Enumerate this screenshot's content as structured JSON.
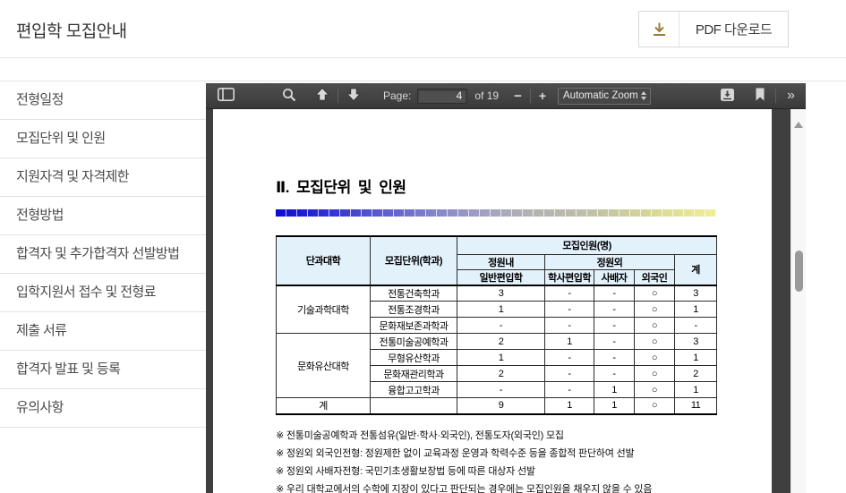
{
  "page": {
    "title": "편입학 모집안내",
    "download_button_label": "PDF 다운로드"
  },
  "sidebar": {
    "items": [
      {
        "label": "전형일정"
      },
      {
        "label": "모집단위 및 인원"
      },
      {
        "label": "지원자격 및 자격제한"
      },
      {
        "label": "전형방법"
      },
      {
        "label": "합격자 및 추가합격자 선발방법"
      },
      {
        "label": "입학지원서 접수 및 전형료"
      },
      {
        "label": "제출 서류"
      },
      {
        "label": "합격자 발표 및 등록"
      },
      {
        "label": "유의사항"
      }
    ]
  },
  "pdf_viewer": {
    "toolbar": {
      "page_label": "Page:",
      "page_value": "4",
      "page_count": "of 19",
      "zoom_out": "−",
      "zoom_in": "+",
      "zoom_select": "Automatic Zoom",
      "more_tools": "»"
    },
    "document": {
      "section_title": "Ⅱ. 모집단위 및 인원",
      "table": {
        "headers": {
          "college": "단과대학",
          "unit": "모집단위(학과)",
          "quota_group": "모집인원(명)",
          "in_quota": "정원내",
          "out_quota": "정원외",
          "col_regular": "일반편입학",
          "col_bachelor": "학사편입학",
          "col_social": "사배자",
          "col_foreign": "외국인",
          "col_total": "계"
        },
        "groups": [
          {
            "college": "기술과학대학",
            "rows": [
              {
                "dept": "전통건축학과",
                "values": [
                  "3",
                  "-",
                  "-",
                  "○",
                  "3"
                ]
              },
              {
                "dept": "전통조경학과",
                "values": [
                  "1",
                  "-",
                  "-",
                  "○",
                  "1"
                ]
              },
              {
                "dept": "문화재보존과학과",
                "values": [
                  "-",
                  "-",
                  "-",
                  "○",
                  "-"
                ]
              }
            ]
          },
          {
            "college": "문화유산대학",
            "rows": [
              {
                "dept": "전통미술공예학과",
                "values": [
                  "2",
                  "1",
                  "-",
                  "○",
                  "3"
                ]
              },
              {
                "dept": "무형유산학과",
                "values": [
                  "1",
                  "-",
                  "-",
                  "○",
                  "1"
                ]
              },
              {
                "dept": "문화재관리학과",
                "values": [
                  "2",
                  "-",
                  "-",
                  "○",
                  "2"
                ]
              },
              {
                "dept": "융합고고학과",
                "values": [
                  "-",
                  "-",
                  "1",
                  "○",
                  "1"
                ]
              }
            ]
          }
        ],
        "total_row": {
          "label": "계",
          "dept": "",
          "values": [
            "9",
            "1",
            "1",
            "○",
            "11"
          ]
        }
      },
      "notes": [
        "※ 전통미술공예학과 전통섬유(일반·학사·외국인), 전통도자(외국인) 모집",
        "※ 정원외 외국인전형: 정원제한 없이 교육과정 운영과 학력수준 등을 종합적 판단하여 선발",
        "※ 정원외 사배자전형: 국민기초생활보장법 등에 따른 대상자 선발",
        "※ 우리 대학교에서의 수학에 지장이 있다고 판단되는 경우에는 모집인원을 채우지 않을 수 있음"
      ]
    }
  },
  "colors": {
    "accent_gold": "#9a7c39",
    "table_header_bg": "#e3f1fb",
    "toolbar_bg": "#474747",
    "gradient_start": "#0b0bd6",
    "gradient_end": "#efef9b"
  }
}
